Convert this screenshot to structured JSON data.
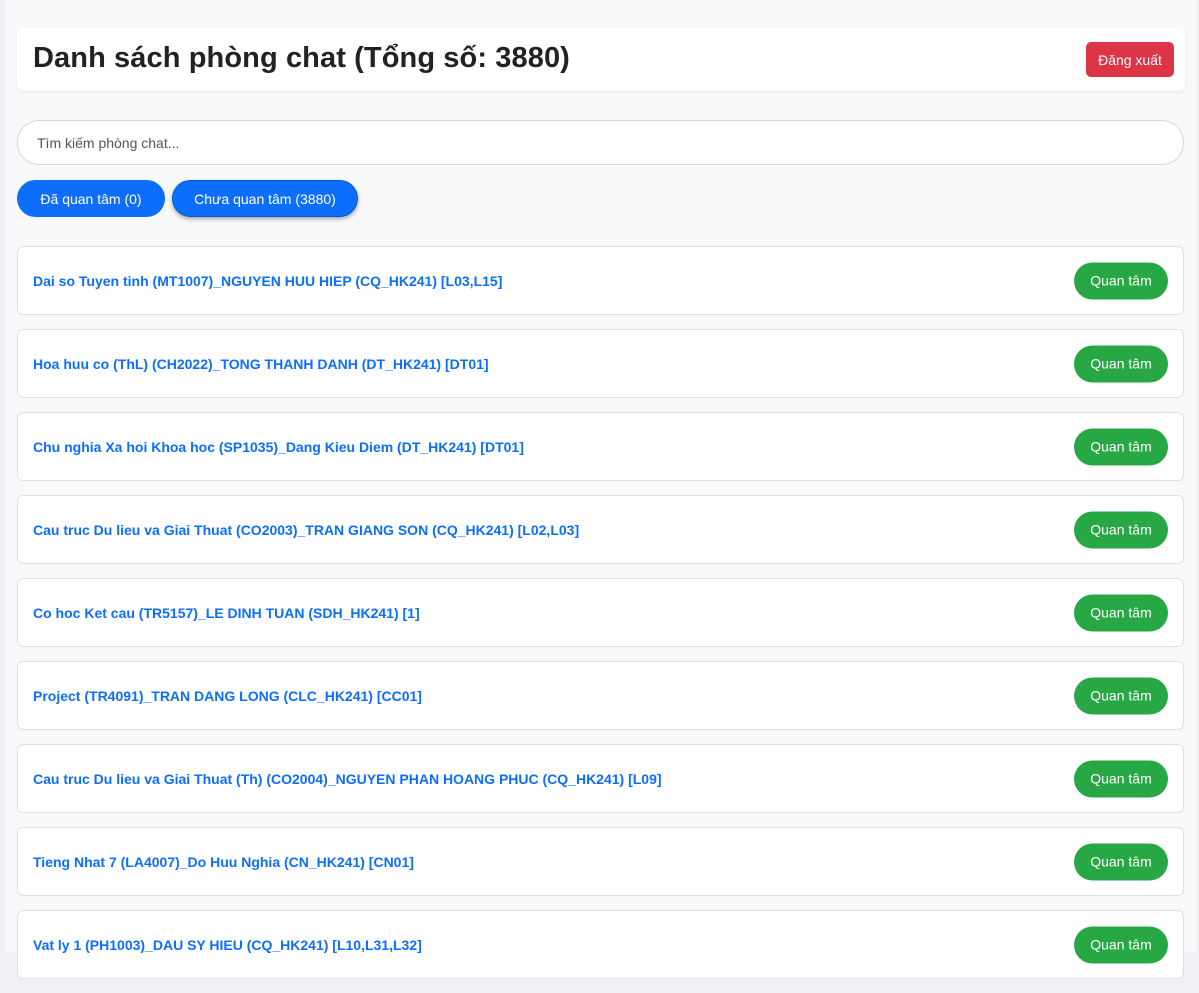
{
  "header": {
    "title": "Danh sách phòng chat (Tổng số: 3880)",
    "logout_label": "Đăng xuất"
  },
  "search": {
    "placeholder": "Tìm kiếm phòng chat..."
  },
  "tabs": [
    {
      "label": "Đã quan tâm (0)"
    },
    {
      "label": "Chưa quan tâm (3880)"
    }
  ],
  "rooms": [
    {
      "name": "Dai so Tuyen tinh (MT1007)_NGUYEN HUU HIEP (CQ_HK241) [L03,L15]",
      "action": "Quan tâm"
    },
    {
      "name": "Hoa huu co (ThL) (CH2022)_TONG THANH DANH (DT_HK241) [DT01]",
      "action": "Quan tâm"
    },
    {
      "name": "Chu nghia Xa hoi Khoa hoc (SP1035)_Dang Kieu Diem (DT_HK241) [DT01]",
      "action": "Quan tâm"
    },
    {
      "name": "Cau truc Du lieu va Giai Thuat (CO2003)_TRAN GIANG SON (CQ_HK241) [L02,L03]",
      "action": "Quan tâm"
    },
    {
      "name": "Co hoc Ket cau (TR5157)_LE DINH TUAN (SDH_HK241) [1]",
      "action": "Quan tâm"
    },
    {
      "name": "Project (TR4091)_TRAN DANG LONG (CLC_HK241) [CC01]",
      "action": "Quan tâm"
    },
    {
      "name": "Cau truc Du lieu va Giai Thuat (Th) (CO2004)_NGUYEN PHAN HOANG PHUC (CQ_HK241) [L09]",
      "action": "Quan tâm"
    },
    {
      "name": "Tieng Nhat 7 (LA4007)_Do Huu Nghia (CN_HK241) [CN01]",
      "action": "Quan tâm"
    },
    {
      "name": "Vat ly 1 (PH1003)_DAU SY HIEU (CQ_HK241) [L10,L31,L32]",
      "action": "Quan tâm"
    }
  ],
  "colors": {
    "primary": "#0d6efd",
    "danger": "#dc3545",
    "success": "#28a745"
  }
}
